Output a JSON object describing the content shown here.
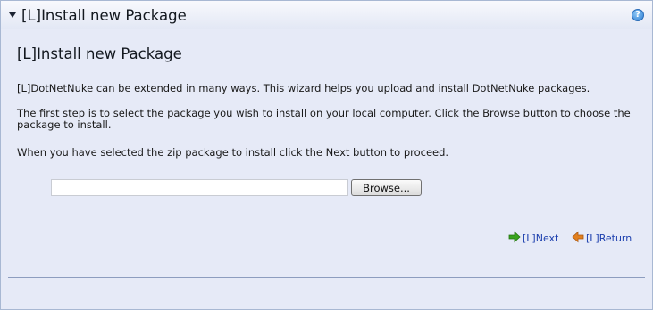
{
  "panel": {
    "title": "[L]Install new Package",
    "help_icon": "help-icon"
  },
  "content": {
    "heading": "[L]Install new Package",
    "paragraph_1": "[L]DotNetNuke can be extended in many ways. This wizard helps you upload and install DotNetNuke packages.",
    "paragraph_2": "The first step is to select the package you wish to install on your local computer. Click the Browse button to choose the package to install.",
    "paragraph_3": "When you have selected the zip package to install click the Next button to proceed."
  },
  "upload": {
    "file_value": "",
    "browse_label": "Browse..."
  },
  "actions": {
    "next_label": "[L]Next",
    "next_icon": "arrow-right-icon",
    "return_label": "[L]Return",
    "return_icon": "arrow-left-icon"
  },
  "colors": {
    "panel_bg": "#e6eaf7",
    "link": "#1c3fae",
    "next_arrow": "#39a31d",
    "return_arrow": "#e2801e"
  }
}
